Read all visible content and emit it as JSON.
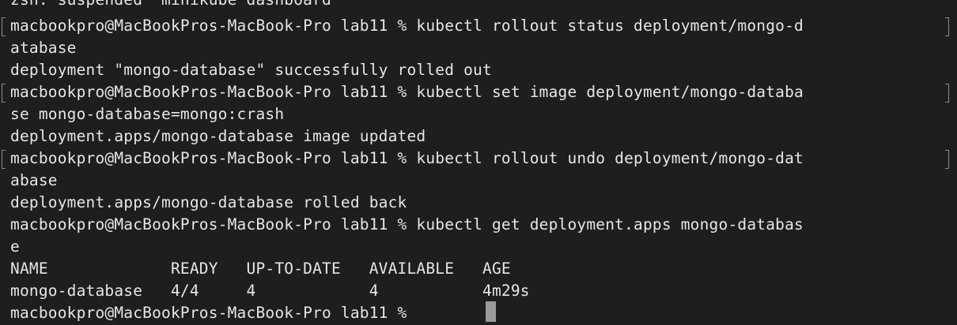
{
  "terminal": {
    "lines": [
      "zsh: suspended  minikube dashboard",
      "macbookpro@MacBookPros-MacBook-Pro lab11 % kubectl rollout status deployment/mongo-d",
      "atabase",
      "deployment \"mongo-database\" successfully rolled out",
      "macbookpro@MacBookPros-MacBook-Pro lab11 % kubectl set image deployment/mongo-databa",
      "se mongo-database=mongo:crash",
      "deployment.apps/mongo-database image updated",
      "macbookpro@MacBookPros-MacBook-Pro lab11 % kubectl rollout undo deployment/mongo-dat",
      "abase",
      "deployment.apps/mongo-database rolled back",
      "macbookpro@MacBookPros-MacBook-Pro lab11 % kubectl get deployment.apps mongo-databas",
      "e",
      "NAME             READY   UP-TO-DATE   AVAILABLE   AGE",
      "mongo-database   4/4     4            4           4m29s",
      "macbookpro@MacBookPros-MacBook-Pro lab11 % "
    ]
  },
  "colors": {
    "background": "#1e1e1e",
    "text": "#e6e6e6",
    "cursor": "#9a9a9a"
  }
}
